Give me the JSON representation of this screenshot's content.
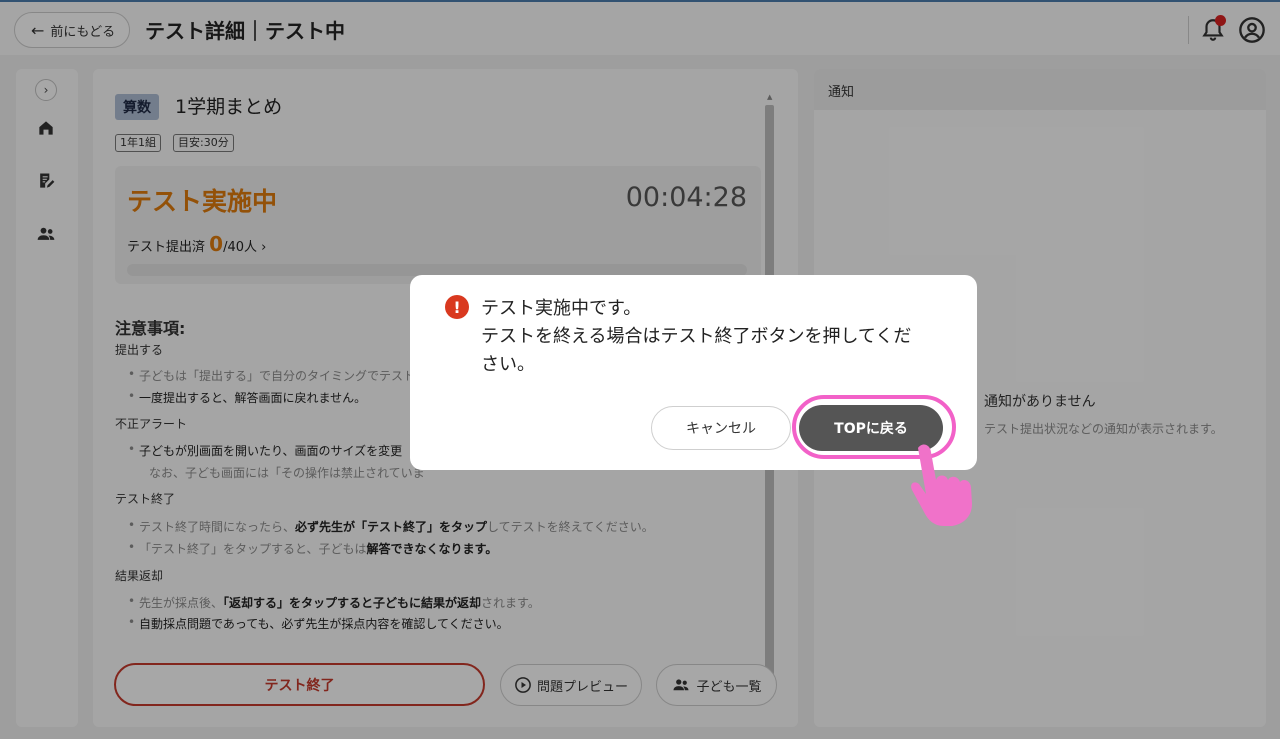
{
  "header": {
    "back_label": "前にもどる",
    "title": "テスト詳細｜テスト中"
  },
  "sidebar": {
    "items": [
      {
        "icon": "chevron-right-icon"
      },
      {
        "icon": "home-icon"
      },
      {
        "icon": "edit-document-icon"
      },
      {
        "icon": "people-icon"
      }
    ]
  },
  "test": {
    "subject": "算数",
    "title": "1学期まとめ",
    "class_chip": "1年1組",
    "time_chip": "目安:30分",
    "status": "テスト実施中",
    "timer": "00:04:28",
    "submitted_label": "テスト提出済",
    "submitted_count": "0",
    "submitted_total": "/40人",
    "progress": 0
  },
  "notes": {
    "title": "注意事項:",
    "sections": [
      {
        "heading": "提出する",
        "bullets": [
          "子どもは「提出する」で自分のタイミングでテスト",
          "一度提出すると、解答画面に戻れません。"
        ]
      },
      {
        "heading": "不正アラート",
        "bullets": [
          "子どもが別画面を開いたり、画面のサイズを変更",
          "なお、子ども画面には「その操作は禁止されていま"
        ]
      },
      {
        "heading": "テスト終了",
        "bullets": [
          "テスト終了時間になったら、",
          "必ず先生が「テスト終了」をタップ",
          "してテストを終えてください。",
          "「テスト終了」をタップすると、子どもは",
          "解答できなくなります。"
        ]
      },
      {
        "heading": "結果返却",
        "bullets": [
          "先生が採点後、",
          "「返却する」をタップすると子どもに結果が返却",
          "されます。",
          "自動採点問題であっても、必ず先生が採点内容を確認してください。"
        ]
      }
    ]
  },
  "actions": {
    "end_test": "テスト終了",
    "preview": "問題プレビュー",
    "children": "子ども一覧"
  },
  "notice": {
    "header": "通知",
    "empty": "通知がありません",
    "sub": "テスト提出状況などの通知が表示されます。"
  },
  "dialog": {
    "line1": "テスト実施中です。",
    "line2": "テストを終える場合はテスト終了ボタンを押してくだ",
    "line3": "さい。",
    "cancel": "キャンセル",
    "confirm": "TOPに戻る"
  },
  "colors": {
    "accent_orange": "#d9780c",
    "danger_red": "#c0382b",
    "highlight_pink": "#f261c8",
    "button_dark": "#555555"
  }
}
